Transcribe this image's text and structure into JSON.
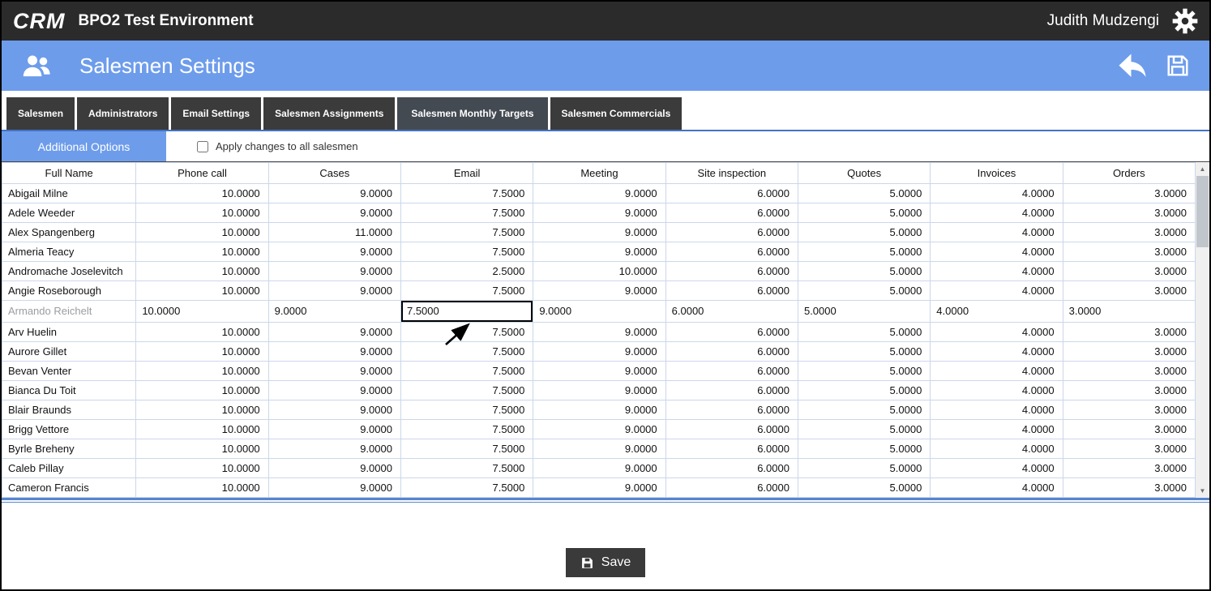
{
  "topbar": {
    "logo": "CRM",
    "title": "BPO2 Test Environment",
    "user": "Judith Mudzengi"
  },
  "header": {
    "title": "Salesmen Settings"
  },
  "tabs": [
    {
      "label": "Salesmen",
      "active": false
    },
    {
      "label": "Administrators",
      "active": false
    },
    {
      "label": "Email Settings",
      "active": false
    },
    {
      "label": "Salesmen Assignments",
      "active": false
    },
    {
      "label": "Salesmen Monthly Targets",
      "active": true
    },
    {
      "label": "Salesmen Commercials",
      "active": false
    }
  ],
  "options": {
    "additional_options_label": "Additional Options",
    "apply_all_label": "Apply changes to all salesmen",
    "apply_all_checked": false
  },
  "table": {
    "columns": [
      "Full Name",
      "Phone call",
      "Cases",
      "Email",
      "Meeting",
      "Site inspection",
      "Quotes",
      "Invoices",
      "Orders"
    ],
    "rows": [
      {
        "name": "Abigail Milne",
        "values": [
          "10.0000",
          "9.0000",
          "7.5000",
          "9.0000",
          "6.0000",
          "5.0000",
          "4.0000",
          "3.0000"
        ]
      },
      {
        "name": "Adele Weeder",
        "values": [
          "10.0000",
          "9.0000",
          "7.5000",
          "9.0000",
          "6.0000",
          "5.0000",
          "4.0000",
          "3.0000"
        ]
      },
      {
        "name": "Alex Spangenberg",
        "values": [
          "10.0000",
          "11.0000",
          "7.5000",
          "9.0000",
          "6.0000",
          "5.0000",
          "4.0000",
          "3.0000"
        ]
      },
      {
        "name": "Almeria Teacy",
        "values": [
          "10.0000",
          "9.0000",
          "7.5000",
          "9.0000",
          "6.0000",
          "5.0000",
          "4.0000",
          "3.0000"
        ]
      },
      {
        "name": "Andromache Joselevitch",
        "values": [
          "10.0000",
          "9.0000",
          "2.5000",
          "10.0000",
          "6.0000",
          "5.0000",
          "4.0000",
          "3.0000"
        ]
      },
      {
        "name": "Angie Roseborough",
        "values": [
          "10.0000",
          "9.0000",
          "7.5000",
          "9.0000",
          "6.0000",
          "5.0000",
          "4.0000",
          "3.0000"
        ]
      },
      {
        "name": "Armando Reichelt",
        "values": [
          "10.0000",
          "9.0000",
          "7.5000",
          "9.0000",
          "6.0000",
          "5.0000",
          "4.0000",
          "3.0000"
        ]
      },
      {
        "name": "Arv Huelin",
        "values": [
          "10.0000",
          "9.0000",
          "7.5000",
          "9.0000",
          "6.0000",
          "5.0000",
          "4.0000",
          "3.0000"
        ]
      },
      {
        "name": "Aurore Gillet",
        "values": [
          "10.0000",
          "9.0000",
          "7.5000",
          "9.0000",
          "6.0000",
          "5.0000",
          "4.0000",
          "3.0000"
        ]
      },
      {
        "name": "Bevan Venter",
        "values": [
          "10.0000",
          "9.0000",
          "7.5000",
          "9.0000",
          "6.0000",
          "5.0000",
          "4.0000",
          "3.0000"
        ]
      },
      {
        "name": "Bianca Du Toit",
        "values": [
          "10.0000",
          "9.0000",
          "7.5000",
          "9.0000",
          "6.0000",
          "5.0000",
          "4.0000",
          "3.0000"
        ]
      },
      {
        "name": "Blair Braunds",
        "values": [
          "10.0000",
          "9.0000",
          "7.5000",
          "9.0000",
          "6.0000",
          "5.0000",
          "4.0000",
          "3.0000"
        ]
      },
      {
        "name": "Brigg Vettore",
        "values": [
          "10.0000",
          "9.0000",
          "7.5000",
          "9.0000",
          "6.0000",
          "5.0000",
          "4.0000",
          "3.0000"
        ]
      },
      {
        "name": "Byrle Breheny",
        "values": [
          "10.0000",
          "9.0000",
          "7.5000",
          "9.0000",
          "6.0000",
          "5.0000",
          "4.0000",
          "3.0000"
        ]
      },
      {
        "name": "Caleb Pillay",
        "values": [
          "10.0000",
          "9.0000",
          "7.5000",
          "9.0000",
          "6.0000",
          "5.0000",
          "4.0000",
          "3.0000"
        ]
      },
      {
        "name": "Cameron Francis",
        "values": [
          "10.0000",
          "9.0000",
          "7.5000",
          "9.0000",
          "6.0000",
          "5.0000",
          "4.0000",
          "3.0000"
        ]
      }
    ],
    "editing_row": "Armando Reichelt",
    "selected_cell": {
      "row": "Armando Reichelt",
      "column": "Email",
      "value": "7.5000"
    }
  },
  "footer": {
    "save_label": "Save"
  },
  "colors": {
    "topbar_bg": "#2b2b2b",
    "header_blue": "#6d9ceb",
    "tab_bg": "#3b3b3b",
    "accent_blue": "#4472c4",
    "grid_line": "#cbd7eb"
  }
}
